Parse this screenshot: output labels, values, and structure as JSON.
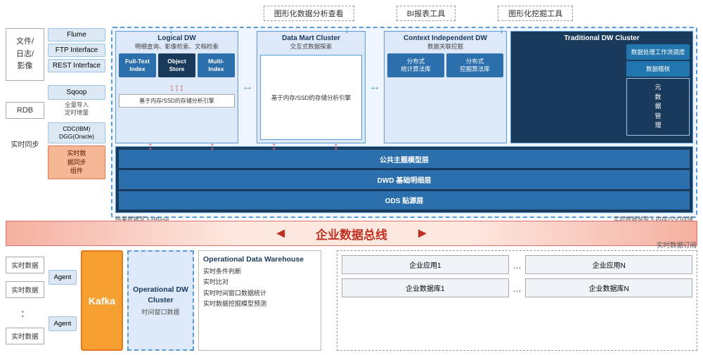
{
  "top_tools": {
    "item1": "图形化数据分析查看",
    "item2": "BI报表工具",
    "item3": "图形化挖掘工具"
  },
  "left_column": {
    "file_label": "文件/\n日志/\n影像",
    "rdb_label": "RDB",
    "realtime_label": "实时同步"
  },
  "connectors": {
    "flume": "Flume",
    "ftp": "FTP Interface",
    "rest": "REST Interface",
    "sqoop": "Sqoop",
    "batch_label": "全量导入\n定时增量",
    "cdc": "CDC(IBM)\nDGG(Oracle)",
    "realtime_sync": "实时数\n据同步\n组件"
  },
  "logical_dw": {
    "title": "Logical DW",
    "subtitle": "明细查询、影像检索、文档检索",
    "index1_line1": "Full-Text",
    "index1_line2": "Index",
    "index2_line1": "Object",
    "index2_line2": "Store",
    "index3_line1": "Multi-",
    "index3_line2": "Index",
    "storage_label": "基于内存/SSD的存储分析引擎"
  },
  "data_mart": {
    "title": "Data Mart Cluster",
    "subtitle": "交互式数据探索",
    "storage_label": "基于内存/SSD的存储分析引擎"
  },
  "context_dw": {
    "title": "Context Independent DW",
    "subtitle": "数据关联挖掘",
    "algo1_line1": "分布式",
    "algo1_line2": "统计算法库",
    "algo2_line1": "分布式",
    "algo2_line2": "挖掘算法库"
  },
  "traditional_dw": {
    "title": "Traditional DW Cluster",
    "btn1": "数据处理工作流调度",
    "btn2": "数据稽核",
    "meta": "元\n数\n据\n管\n理"
  },
  "layers": {
    "layer1": "公共主题模型层",
    "layer2": "DWD 基础明细层",
    "layer3": "ODS 贴源层"
  },
  "annotations": {
    "left_note": "结果数据写入HBase\n提供检索和查询功能",
    "right_note": "实时数据装载入内存/SSD存储\n准实时分析"
  },
  "enterprise_bus": {
    "label": "企业数据总线"
  },
  "bottom": {
    "rt_sources": [
      "实时数据",
      "实时数据",
      "：",
      "实时数据"
    ],
    "agent1": "Agent",
    "agent2": "Agent",
    "kafka": "Kafka",
    "op_dw_title": "Operational DW Cluster",
    "op_dw_sub": "时间窗口数据",
    "op_dw_right_title": "Operational Data Warehouse",
    "op_dw_items": [
      "实时条件判断",
      "实时比对",
      "实时时间窗口数据统计",
      "实时数据挖掘模型预测"
    ],
    "rt_subscribe_label": "实时数据订阅",
    "app_row1": [
      "企业应用1",
      "...",
      "企业应用N"
    ],
    "app_row2": [
      "企业数据库1",
      "...",
      "企业数据库N"
    ]
  }
}
